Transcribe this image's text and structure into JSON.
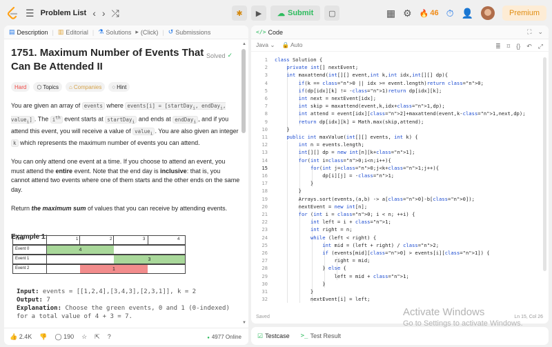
{
  "topbar": {
    "problem_list": "Problem List",
    "submit": "Submit",
    "streak": "46",
    "premium": "Premium"
  },
  "left_tabs": {
    "description": "Description",
    "editorial": "Editorial",
    "solutions": "Solutions",
    "click_hint": "(Click)",
    "submissions": "Submissions"
  },
  "problem": {
    "title": "1751. Maximum Number of Events That Can Be Attended II",
    "solved": "Solved",
    "chips": {
      "difficulty": "Hard",
      "topics": "Topics",
      "companies": "Companies",
      "hint": "Hint"
    },
    "para1": {
      "t1": "You are given an array of ",
      "c1": "events",
      "t2": " where ",
      "c2": "events[i] = [startDay",
      "c2_sub": "i",
      "c3": ", endDay",
      "c3_sub": "i",
      "c4": ", value",
      "c4_sub": "i",
      "c5": "]",
      "t3": ". The ",
      "t4": "i",
      "t4_sup": "th",
      "t5": " event starts at ",
      "c6": "startDay",
      "c6_sub": "i",
      "t6": " and ends at ",
      "c7": "endDay",
      "c7_sub": "i",
      "t7": ", and if you attend this event, you will receive a value of ",
      "c8": "value",
      "c8_sub": "i",
      "t8": ". You are also given an integer ",
      "c9": "k",
      "t9": " which represents the maximum number of events you can attend."
    },
    "para2": {
      "t1": "You can only attend one event at a time. If you choose to attend an event, you must attend the ",
      "b1": "entire",
      "t2": " event. Note that the end day is ",
      "b2": "inclusive",
      "t3": ": that is, you cannot attend two events where one of them starts and the other ends on the same day."
    },
    "para3": {
      "t1": "Return ",
      "b1": "the maximum sum",
      "t2": " of values that you can receive by attending events."
    },
    "example_title": "Example 1:",
    "example_grid": {
      "header": "Time",
      "ticks": [
        "1",
        "2",
        "3",
        "4"
      ],
      "rows": [
        {
          "label": "Event 0",
          "value": "4"
        },
        {
          "label": "Event 1",
          "value": "3"
        },
        {
          "label": "Event 2",
          "value": "1"
        }
      ]
    },
    "example_text": {
      "input_label": "Input:",
      "input": " events = [[1,2,4],[3,4,3],[2,3,1]], k = 2",
      "output_label": "Output:",
      "output": " 7",
      "expl_label": "Explanation:",
      "expl1": " Choose the green events, 0 and 1 (0-indexed)",
      "expl2": "for a total value of 4 + 3 = 7."
    }
  },
  "left_footer": {
    "likes": "2.4K",
    "comments": "190",
    "online": "4977 Online"
  },
  "code_panel": {
    "title": "Code",
    "language": "Java",
    "mode": "Auto",
    "status": "Saved",
    "position": "Ln 15, Col 26",
    "lines": [
      "class Solution {",
      "    private int[] nextEvent;",
      "    int maxattend(int[][] event,int k,int idx,int[][] dp){",
      "        if(k == 0 || idx >= event.length)return 0;",
      "        if(dp[idx][k] != -1)return dp[idx][k];",
      "        int next = nextEvent[idx];",
      "        int skip = maxattend(event,k,idx+1,dp);",
      "        int attend = event[idx][2]+maxattend(event,k-1,next,dp);",
      "        return dp[idx][k] = Math.max(skip,attend);",
      "    }",
      "    public int maxValue(int[][] events, int k) {",
      "        int n = events.length;",
      "        int[][] dp = new int[n][k+1];",
      "        for(int i=0;i<n;i++){",
      "            for(int j=0;j<k+1;j++){",
      "                dp[i][j] = -1;",
      "            }",
      "        }",
      "        Arrays.sort(events,(a,b) -> a[0]-b[0]);",
      "        nextEvent = new int[n];",
      "        for (int i = 0; i < n; ++i) {",
      "            int left = i + 1;",
      "            int right = n;",
      "            while (left < right) {",
      "                int mid = (left + right) / 2;",
      "                if (events[mid][0] > events[i][1]) {",
      "                    right = mid;",
      "                } else {",
      "                    left = mid + 1;",
      "                }",
      "            }",
      "            nextEvent[i] = left;"
    ]
  },
  "bottom_panel": {
    "testcase": "Testcase",
    "test_result": "Test Result"
  },
  "watermark": {
    "line1": "Activate Windows",
    "line2": "Go to Settings to activate Windows."
  }
}
